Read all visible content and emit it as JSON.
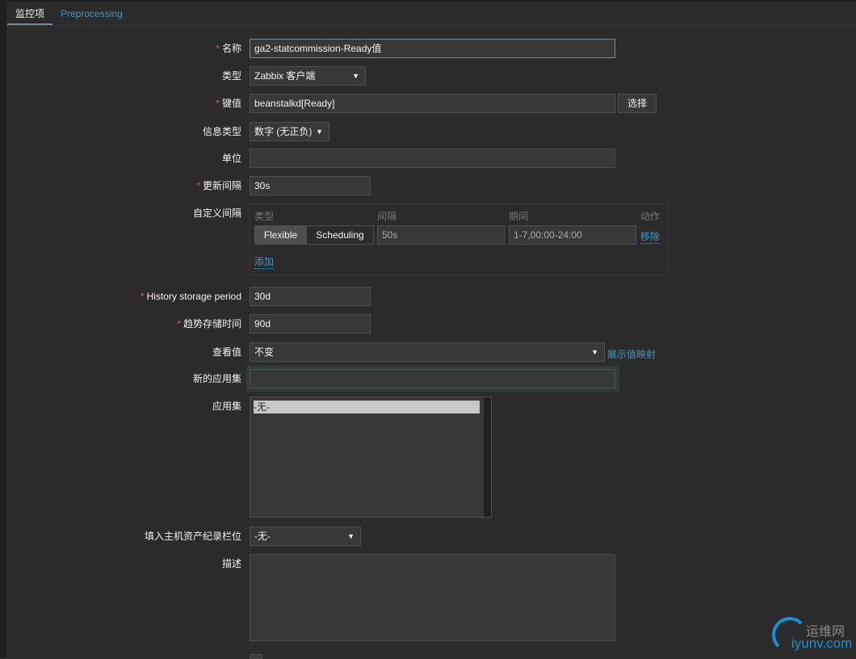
{
  "tabs": [
    {
      "label": "监控项"
    },
    {
      "label": "Preprocessing"
    }
  ],
  "form": {
    "name": {
      "label": "名称",
      "value": "ga2-statcommission-Ready值"
    },
    "type": {
      "label": "类型",
      "value": "Zabbix 客户端"
    },
    "key": {
      "label": "键值",
      "value": "beanstalkd[Ready]",
      "button": "选择"
    },
    "info_type": {
      "label": "信息类型",
      "value": "数字 (无正负)"
    },
    "unit": {
      "label": "单位",
      "value": ""
    },
    "update_interval": {
      "label": "更新间隔",
      "value": "30s"
    },
    "custom_intervals": {
      "label": "自定义间隔",
      "headers": [
        "类型",
        "间隔",
        "期间",
        "动作"
      ],
      "rows": [
        {
          "modes": [
            "Flexible",
            "Scheduling"
          ],
          "selected": "Flexible",
          "interval": "50s",
          "period": "1-7,00:00-24:00",
          "action": "移除"
        }
      ],
      "add": "添加"
    },
    "history": {
      "label": "History storage period",
      "value": "30d"
    },
    "trends": {
      "label": "趋势存储时间",
      "value": "90d"
    },
    "show_value": {
      "label": "查看值",
      "value": "不变",
      "link": "展示值映射"
    },
    "new_application": {
      "label": "新的应用集",
      "value": ""
    },
    "applications": {
      "label": "应用集",
      "options": [
        "-无-"
      ]
    },
    "inventory": {
      "label": "填入主机资产纪录栏位",
      "value": "-无-"
    },
    "description": {
      "label": "描述",
      "value": ""
    }
  },
  "watermark": {
    "cn": "运维网",
    "en": "iyunv.com"
  },
  "colors": {
    "accent": "#4796c4",
    "required": "#e45959",
    "background": "#2b2b2b"
  }
}
